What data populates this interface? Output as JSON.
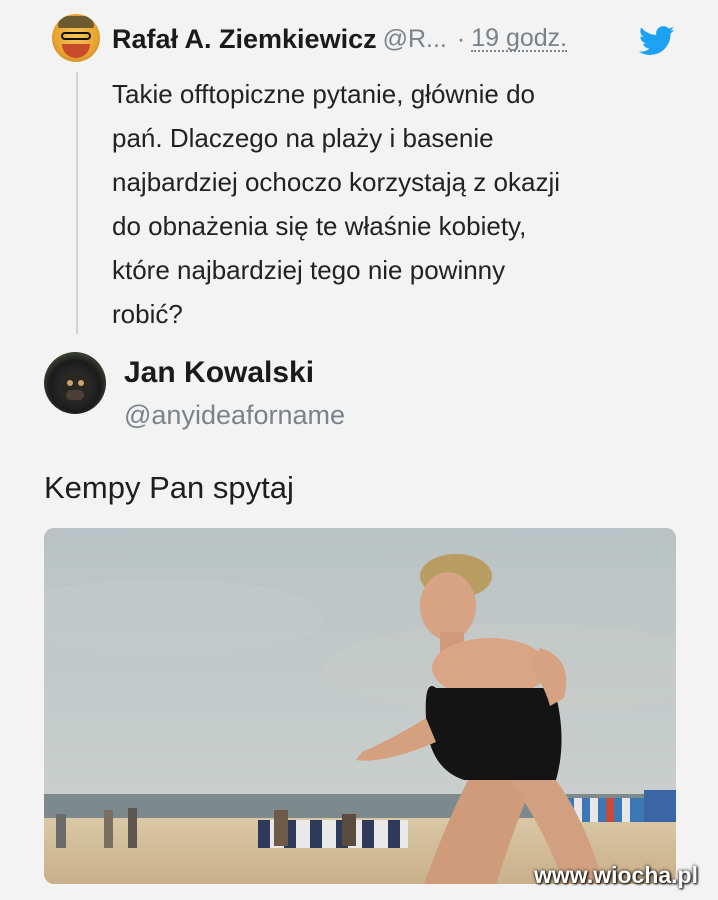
{
  "tweet": {
    "author_name": "Rafał A. Ziemkiewicz",
    "author_handle": "@R...",
    "separator": "·",
    "time": "19 godz.",
    "lines": [
      "Takie offtopiczne pytanie, głównie do",
      "pań. Dlaczego na plaży i basenie",
      "najbardziej ochoczo korzystają z okazji",
      "do obnażenia się te właśnie kobiety,",
      "które najbardziej tego nie powinny",
      "robić?"
    ]
  },
  "reply": {
    "author_name": "Jan Kowalski",
    "author_handle": "@anyideaforname",
    "text": "Kempy Pan spytaj"
  },
  "watermark": "www.wiocha.pl",
  "icons": {
    "bird": "twitter-bird-icon"
  },
  "colors": {
    "twitter_blue": "#1da1f2",
    "muted_text": "#7a838b",
    "background": "#f2f3f2"
  }
}
